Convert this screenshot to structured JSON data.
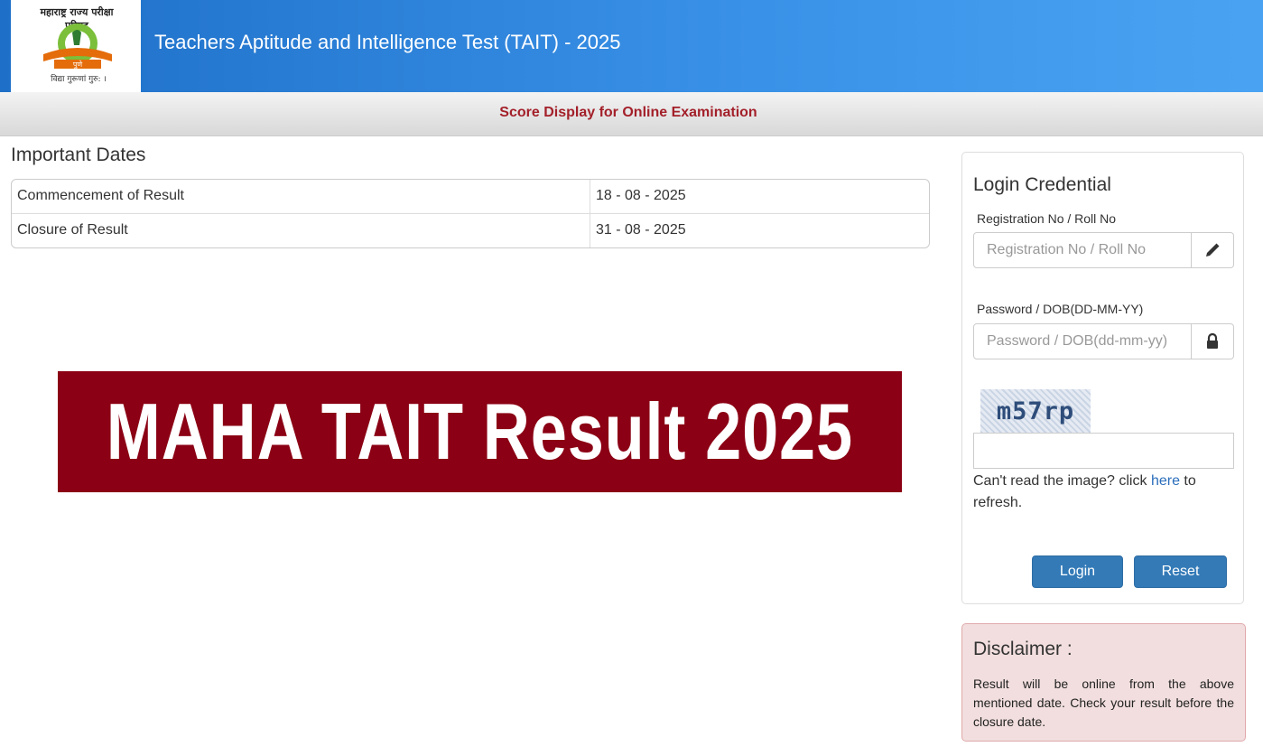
{
  "header": {
    "logo": {
      "arc_text": "महाराष्ट्र राज्य परीक्षा परिषद",
      "ribbon_text": "पुणे",
      "caption": "विद्या गुरूणां गुरु: ।"
    },
    "title": "Teachers Aptitude and Intelligence Test (TAIT) - 2025"
  },
  "subheader": {
    "title": "Score Display for Online Examination"
  },
  "important_dates": {
    "title": "Important Dates",
    "rows": [
      {
        "label": "Commencement of Result",
        "value": "18 - 08 - 2025"
      },
      {
        "label": "Closure of Result",
        "value": "31 - 08 - 2025"
      }
    ]
  },
  "banner": {
    "text": "MAHA TAIT Result 2025"
  },
  "login": {
    "title": "Login Credential",
    "registration_label": "Registration No / Roll No",
    "registration_placeholder": "Registration No / Roll No",
    "registration_icon": "pencil-icon",
    "password_label": "Password / DOB(DD-MM-YY)",
    "password_placeholder": "Password / DOB(dd-mm-yy)",
    "password_icon": "lock-icon",
    "captcha_text": "m57rp",
    "refresh_prefix": "Can't read the image? click ",
    "refresh_link": "here",
    "refresh_suffix": " to refresh.",
    "login_button": "Login",
    "reset_button": "Reset"
  },
  "disclaimer": {
    "title": "Disclaimer :",
    "text": "Result will be online from the above mentioned date. Check your result before the closure date."
  },
  "colors": {
    "header_blue": "#2a80d8",
    "subheader_title": "#a3202a",
    "banner_bg": "#8b0014",
    "button_blue": "#337ab7",
    "disclaimer_bg": "#f2dede"
  }
}
